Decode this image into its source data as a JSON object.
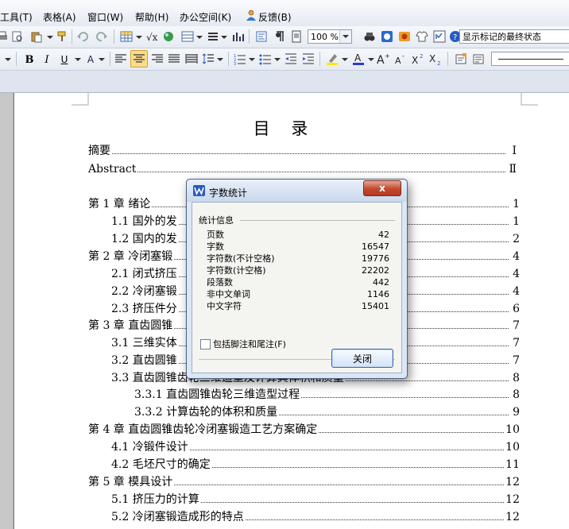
{
  "menu": {
    "items": [
      "工具(T)",
      "表格(A)",
      "窗口(W)",
      "帮助(H)",
      "办公空间(K)",
      "反馈(B)"
    ]
  },
  "toolbar": {
    "zoom": "100 %",
    "review_mode": "显示标记的最终状态"
  },
  "document": {
    "toc_title": "目 录",
    "entries": [
      {
        "label": "摘要",
        "page": "Ⅰ"
      },
      {
        "label": "Abstract",
        "page": "Ⅱ"
      },
      {
        "label": "第 1 章  绪论",
        "page": "1"
      },
      {
        "label": "1.1  国外的发",
        "page": "1"
      },
      {
        "label": "1.2  国内的发",
        "page": "2"
      },
      {
        "label": "第 2 章  冷闭塞锻",
        "page": "4"
      },
      {
        "label": "2.1  闭式挤压",
        "page": "4"
      },
      {
        "label": "2.2  冷闭塞锻",
        "page": "4"
      },
      {
        "label": "2.3  挤压件分",
        "page": "6"
      },
      {
        "label": "第 3 章  直齿圆锥",
        "page": "7"
      },
      {
        "label": "3.1  三维实体",
        "page": "7"
      },
      {
        "label": "3.2  直齿圆锥",
        "page": "7"
      },
      {
        "label": "3.3  直齿圆锥齿轮三维造型及计算其体积和质量",
        "page": "8"
      },
      {
        "label": "3.3.1  直齿圆锥齿轮三维造型过程",
        "page": "8"
      },
      {
        "label": "3.3.2  计算齿轮的体积和质量",
        "page": "9"
      },
      {
        "label": "第 4 章  直齿圆锥齿轮冷闭塞锻造工艺方案确定",
        "page": "10"
      },
      {
        "label": "4.1  冷锻件设计",
        "page": "10"
      },
      {
        "label": "4.2  毛坯尺寸的确定",
        "page": "11"
      },
      {
        "label": "第 5 章  模具设计",
        "page": "12"
      },
      {
        "label": "5.1  挤压力的计算",
        "page": "12"
      },
      {
        "label": "5.2  冷闭塞锻造成形的特点",
        "page": "12"
      }
    ]
  },
  "dialog": {
    "title": "字数统计",
    "close_x": "x",
    "group_label": "统计信息",
    "stats": [
      {
        "key": "页数",
        "value": "42"
      },
      {
        "key": "字数",
        "value": "16547"
      },
      {
        "key": "字符数(不计空格)",
        "value": "19776"
      },
      {
        "key": "字符数(计空格)",
        "value": "22202"
      },
      {
        "key": "段落数",
        "value": "442"
      },
      {
        "key": "非中文单词",
        "value": "1146"
      },
      {
        "key": "中文字符",
        "value": "15401"
      }
    ],
    "checkbox_label": "包括脚注和尾注(F)",
    "checkbox_checked": false,
    "close_button": "关闭"
  }
}
